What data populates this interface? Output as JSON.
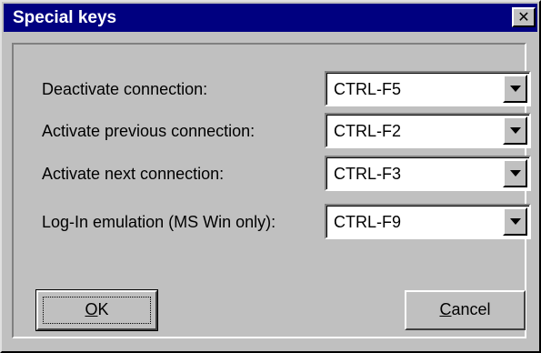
{
  "window": {
    "title": "Special keys",
    "close_glyph": "✕",
    "close_icon": "close-icon"
  },
  "rows": [
    {
      "label": "Deactivate connection:",
      "value": "CTRL-F5"
    },
    {
      "label": "Activate previous connection:",
      "value": "CTRL-F2"
    },
    {
      "label": "Activate next connection:",
      "value": "CTRL-F3"
    },
    {
      "label": "Log-In emulation (MS Win only):",
      "value": "CTRL-F9"
    }
  ],
  "buttons": {
    "ok": {
      "mnemonic": "O",
      "rest": "K"
    },
    "cancel": {
      "mnemonic": "C",
      "rest": "ancel"
    }
  },
  "colors": {
    "title_bar": "#000080",
    "face": "#c0c0c0"
  }
}
